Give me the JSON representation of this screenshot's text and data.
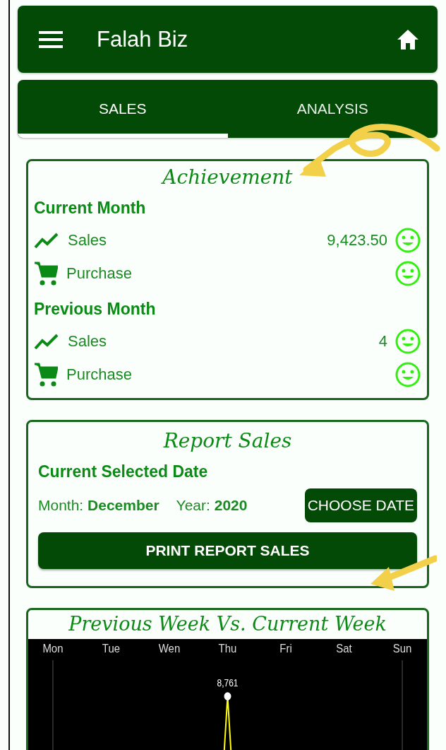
{
  "app_bar": {
    "title": "Falah Biz"
  },
  "tabs": [
    {
      "label": "SALES",
      "selected": true
    },
    {
      "label": "ANALYSIS",
      "selected": false
    }
  ],
  "achievement": {
    "title": "Achievement",
    "groups": [
      {
        "heading": "Current Month",
        "rows": [
          {
            "kind": "sales",
            "label": "Sales",
            "value": "9,423.50"
          },
          {
            "kind": "purchase",
            "label": "Purchase"
          }
        ]
      },
      {
        "heading": "Previous Month",
        "rows": [
          {
            "kind": "sales",
            "label": "Sales",
            "value": "4"
          },
          {
            "kind": "purchase",
            "label": "Purchase"
          }
        ]
      }
    ]
  },
  "report": {
    "title": "Report Sales",
    "subtitle": "Current Selected Date",
    "month_label": "Month:",
    "month": "December",
    "year_label": "Year:",
    "year": "2020",
    "choose_button": "CHOOSE DATE",
    "print_button": "PRINT REPORT SALES"
  },
  "weekly": {
    "title": "Previous Week Vs. Current Week",
    "peak_label": "8,761",
    "days": [
      "Mon",
      "Tue",
      "Wen",
      "Thu",
      "Fri",
      "Sat",
      "Sun"
    ]
  }
}
